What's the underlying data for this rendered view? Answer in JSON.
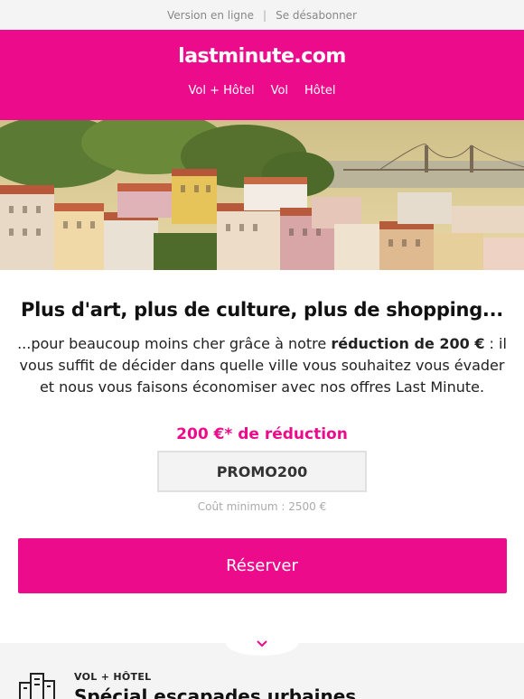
{
  "topbar": {
    "online_version": "Version en ligne",
    "separator": "|",
    "unsubscribe": "Se désabonner"
  },
  "header": {
    "logo": "lastminute.com",
    "nav": [
      "Vol + Hôtel",
      "Vol",
      "Hôtel"
    ]
  },
  "main": {
    "headline": "Plus d'art, plus de culture, plus de shopping...",
    "lead_before": "...pour beaucoup moins cher grâce à notre ",
    "lead_bold": "réduction de 200 €",
    "lead_after": " : il vous suffit de décider dans quelle ville vous souhaitez vous évader et nous vous faisons économiser avec nos offres Last Minute.",
    "promo_title": "200 €* de réduction",
    "promo_code": "PROMO200",
    "min_cost": "Coût minimum : 2500 €",
    "cta_label": "Réserver"
  },
  "next_section": {
    "kicker": "VOL + HÔTEL",
    "title": "Spécial escapades urbaines",
    "icon": "city-buildings-icon"
  },
  "colors": {
    "brand": "#ec0b8b",
    "topbar_bg": "#f4f4f4"
  }
}
